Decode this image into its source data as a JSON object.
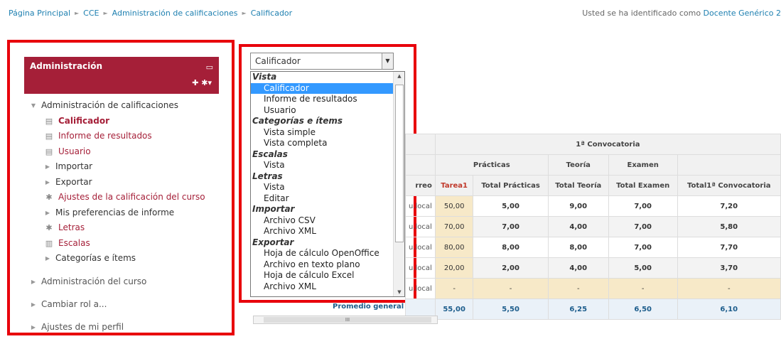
{
  "breadcrumb": [
    "Página Principal",
    "CCE",
    "Administración de calificaciones",
    "Calificador"
  ],
  "login": {
    "prefix": "Usted se ha identificado como",
    "user": "Docente Genérico 2"
  },
  "admin": {
    "title": "Administración",
    "root": "Administración de calificaciones",
    "items": [
      {
        "label": "Calificador",
        "icon": "table-icon",
        "bold": true,
        "link": true
      },
      {
        "label": "Informe de resultados",
        "icon": "table-icon",
        "link": true
      },
      {
        "label": "Usuario",
        "icon": "table-icon",
        "link": true
      },
      {
        "label": "Importar",
        "icon": "arrow-right-icon"
      },
      {
        "label": "Exportar",
        "icon": "arrow-right-icon"
      },
      {
        "label": "Ajustes de la calificación del curso",
        "icon": "gear-icon",
        "link": true
      },
      {
        "label": "Mis preferencias de informe",
        "icon": "arrow-right-icon"
      },
      {
        "label": "Letras",
        "icon": "gear-icon",
        "link": true
      },
      {
        "label": "Escalas",
        "icon": "chart-icon",
        "link": true
      },
      {
        "label": "Categorías e ítems",
        "icon": "arrow-right-icon"
      }
    ],
    "sections": [
      "Administración del curso",
      "Cambiar rol a...",
      "Ajustes de mi perfil"
    ]
  },
  "select": {
    "value": "Calificador"
  },
  "dropdown": [
    {
      "group": "Vista",
      "options": [
        "Calificador",
        "Informe de resultados",
        "Usuario"
      ]
    },
    {
      "group": "Categorías e ítems",
      "options": [
        "Vista simple",
        "Vista completa"
      ]
    },
    {
      "group": "Escalas",
      "options": [
        "Vista"
      ]
    },
    {
      "group": "Letras",
      "options": [
        "Vista",
        "Editar"
      ]
    },
    {
      "group": "Importar",
      "options": [
        "Archivo CSV",
        "Archivo XML"
      ]
    },
    {
      "group": "Exportar",
      "options": [
        "Hoja de cálculo OpenOffice",
        "Archivo en texto plano",
        "Hoja de cálculo Excel",
        "Archivo XML"
      ]
    }
  ],
  "grades": {
    "convocatoria": "1ª Convocatoria",
    "groups": [
      "Prácticas",
      "Teoría",
      "Examen"
    ],
    "columns": [
      "rreo",
      "Tarea1",
      "Total Prácticas",
      "Total Teoría",
      "Total Examen",
      "Total1ª Convocatoria"
    ],
    "rows": [
      {
        "user": "u.local",
        "tarea1": "50,00",
        "practicas": "5,00",
        "teoria": "9,00",
        "examen": "7,00",
        "total": "7,20"
      },
      {
        "user": "u.local",
        "tarea1": "70,00",
        "practicas": "7,00",
        "teoria": "4,00",
        "examen": "7,00",
        "total": "5,80"
      },
      {
        "user": "u.local",
        "tarea1": "80,00",
        "practicas": "8,00",
        "teoria": "8,00",
        "examen": "7,00",
        "total": "7,70"
      },
      {
        "user": "u.local",
        "tarea1": "20,00",
        "practicas": "2,00",
        "teoria": "4,00",
        "examen": "5,00",
        "total": "3,70"
      },
      {
        "user": "u.local",
        "tarea1": "-",
        "practicas": "-",
        "teoria": "-",
        "examen": "-",
        "total": "-"
      }
    ],
    "average": {
      "label": "Promedio general",
      "tarea1": "55,00",
      "practicas": "5,50",
      "teoria": "6,25",
      "examen": "6,50",
      "total": "6,10"
    }
  },
  "scrollbar_mid": "III"
}
